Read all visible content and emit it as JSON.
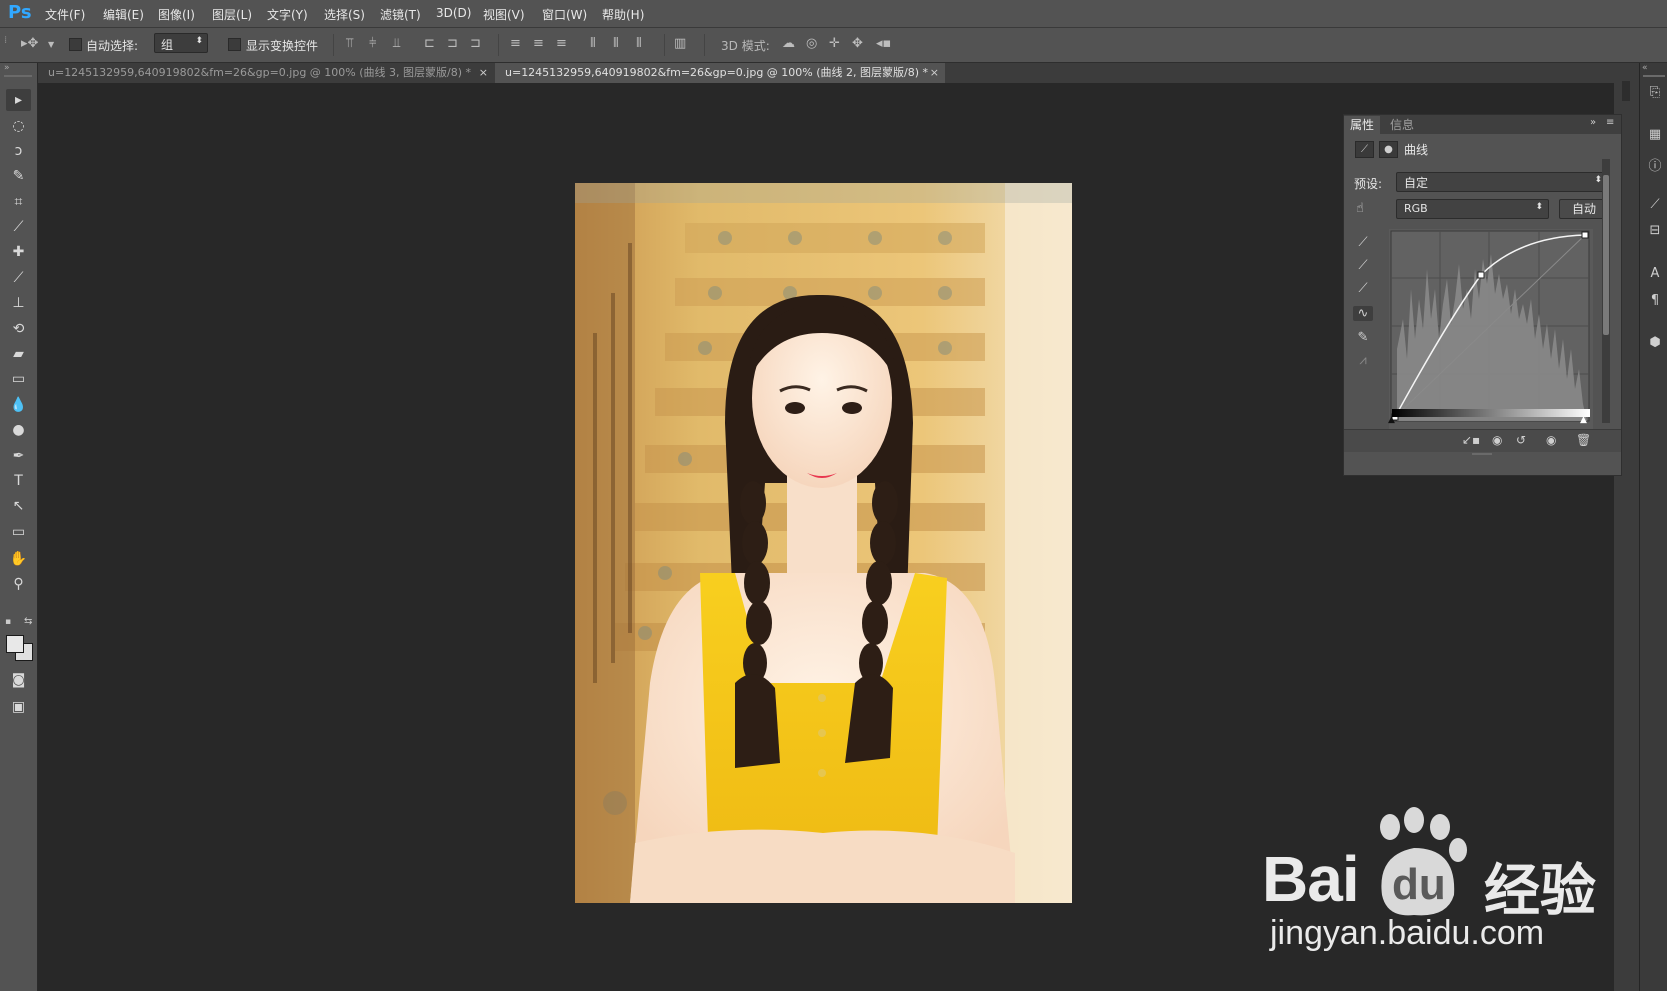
{
  "app": {
    "logo": "Ps"
  },
  "menu": [
    "文件(F)",
    "编辑(E)",
    "图像(I)",
    "图层(L)",
    "文字(Y)",
    "选择(S)",
    "滤镜(T)",
    "3D(D)",
    "视图(V)",
    "窗口(W)",
    "帮助(H)"
  ],
  "options": {
    "auto_select_label": "自动选择:",
    "auto_select_value": "组",
    "show_transform_label": "显示变换控件",
    "mode_3d_label": "3D 模式:"
  },
  "tabs": [
    {
      "label": "u=1245132959,640919802&fm=26&gp=0.jpg @ 100% (曲线 3, 图层蒙版/8) *",
      "active": false
    },
    {
      "label": "u=1245132959,640919802&fm=26&gp=0.jpg @ 100% (曲线 2, 图层蒙版/8) *",
      "active": true
    }
  ],
  "panel": {
    "tabs": [
      "属性",
      "信息"
    ],
    "title": "曲线",
    "preset_label": "预设:",
    "preset_value": "自定",
    "channel_value": "RGB",
    "auto_button": "自动"
  },
  "watermark": {
    "brand_a": "Bai",
    "brand_b": "du",
    "brand_cn": "经验",
    "url": "jingyan.baidu.com"
  },
  "colors": {
    "ui_bg": "#535353",
    "canvas_bg": "#282828",
    "accent_ps": "#31a8ff",
    "dress_yellow": "#f3c21a"
  }
}
